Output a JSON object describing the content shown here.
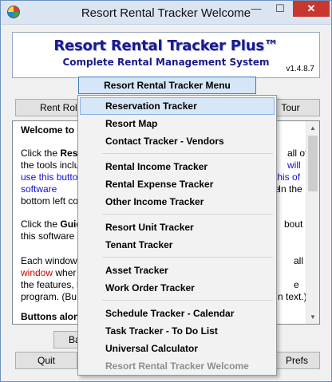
{
  "window": {
    "title": "Resort Rental Tracker Welcome",
    "min_glyph": "—",
    "max_glyph": "☐",
    "close_glyph": "✕"
  },
  "banner": {
    "title": "Resort Rental Tracker Plus™",
    "subtitle": "Complete Rental Management System",
    "version": "v1.4.8.7"
  },
  "menu_button": {
    "label": "Resort Rental Tracker Menu"
  },
  "buttons": {
    "rental_partial": "Rent Rol",
    "tour_partial": "Tour",
    "ba_partial": "Ba",
    "quit": "Quit",
    "prefs_partial": "Prefs"
  },
  "text": {
    "welcome": "Welcome to",
    "p1_a": "Click the ",
    "p1_b": "Resr",
    "p1_c": "all of",
    "p2_a": "the tools inclu",
    "p2_b": "will",
    "p3_a": "use this butto",
    "p3_b": "n this of the",
    "p4_a": "software",
    "p4_b": ". In the",
    "p5": "bottom left co",
    "p6_a": "Click the ",
    "p6_b": "Guid",
    "p6_c": "bout",
    "p7": "this software",
    "p8_a": "Each window",
    "p8_b": "all",
    "p9_a": "window",
    "p9_b": " wher",
    "p10_a": "the features, l",
    "p10_b": "e",
    "p11_a": "program. (Bu",
    "p11_b": "n text.)",
    "p12": "Buttons alon"
  },
  "menu": {
    "groups": [
      [
        "Reservation Tracker",
        "Resort Map",
        "Contact Tracker - Vendors"
      ],
      [
        "Rental Income Tracker",
        "Rental Expense Tracker",
        "Other Income Tracker"
      ],
      [
        "Resort Unit Tracker",
        "Tenant Tracker"
      ],
      [
        "Asset Tracker",
        "Work Order Tracker"
      ],
      [
        "Schedule Tracker - Calendar",
        "Task Tracker - To Do List",
        "Universal Calculator",
        "Resort Rental Tracker Welcome"
      ]
    ],
    "selected": "Reservation Tracker",
    "disabled": "Resort Rental Tracker Welcome"
  },
  "colors": {
    "accent": "#1a1a8c",
    "link_blue": "#1010d0",
    "link_red": "#d00000",
    "selection": "#d8e7f7"
  }
}
